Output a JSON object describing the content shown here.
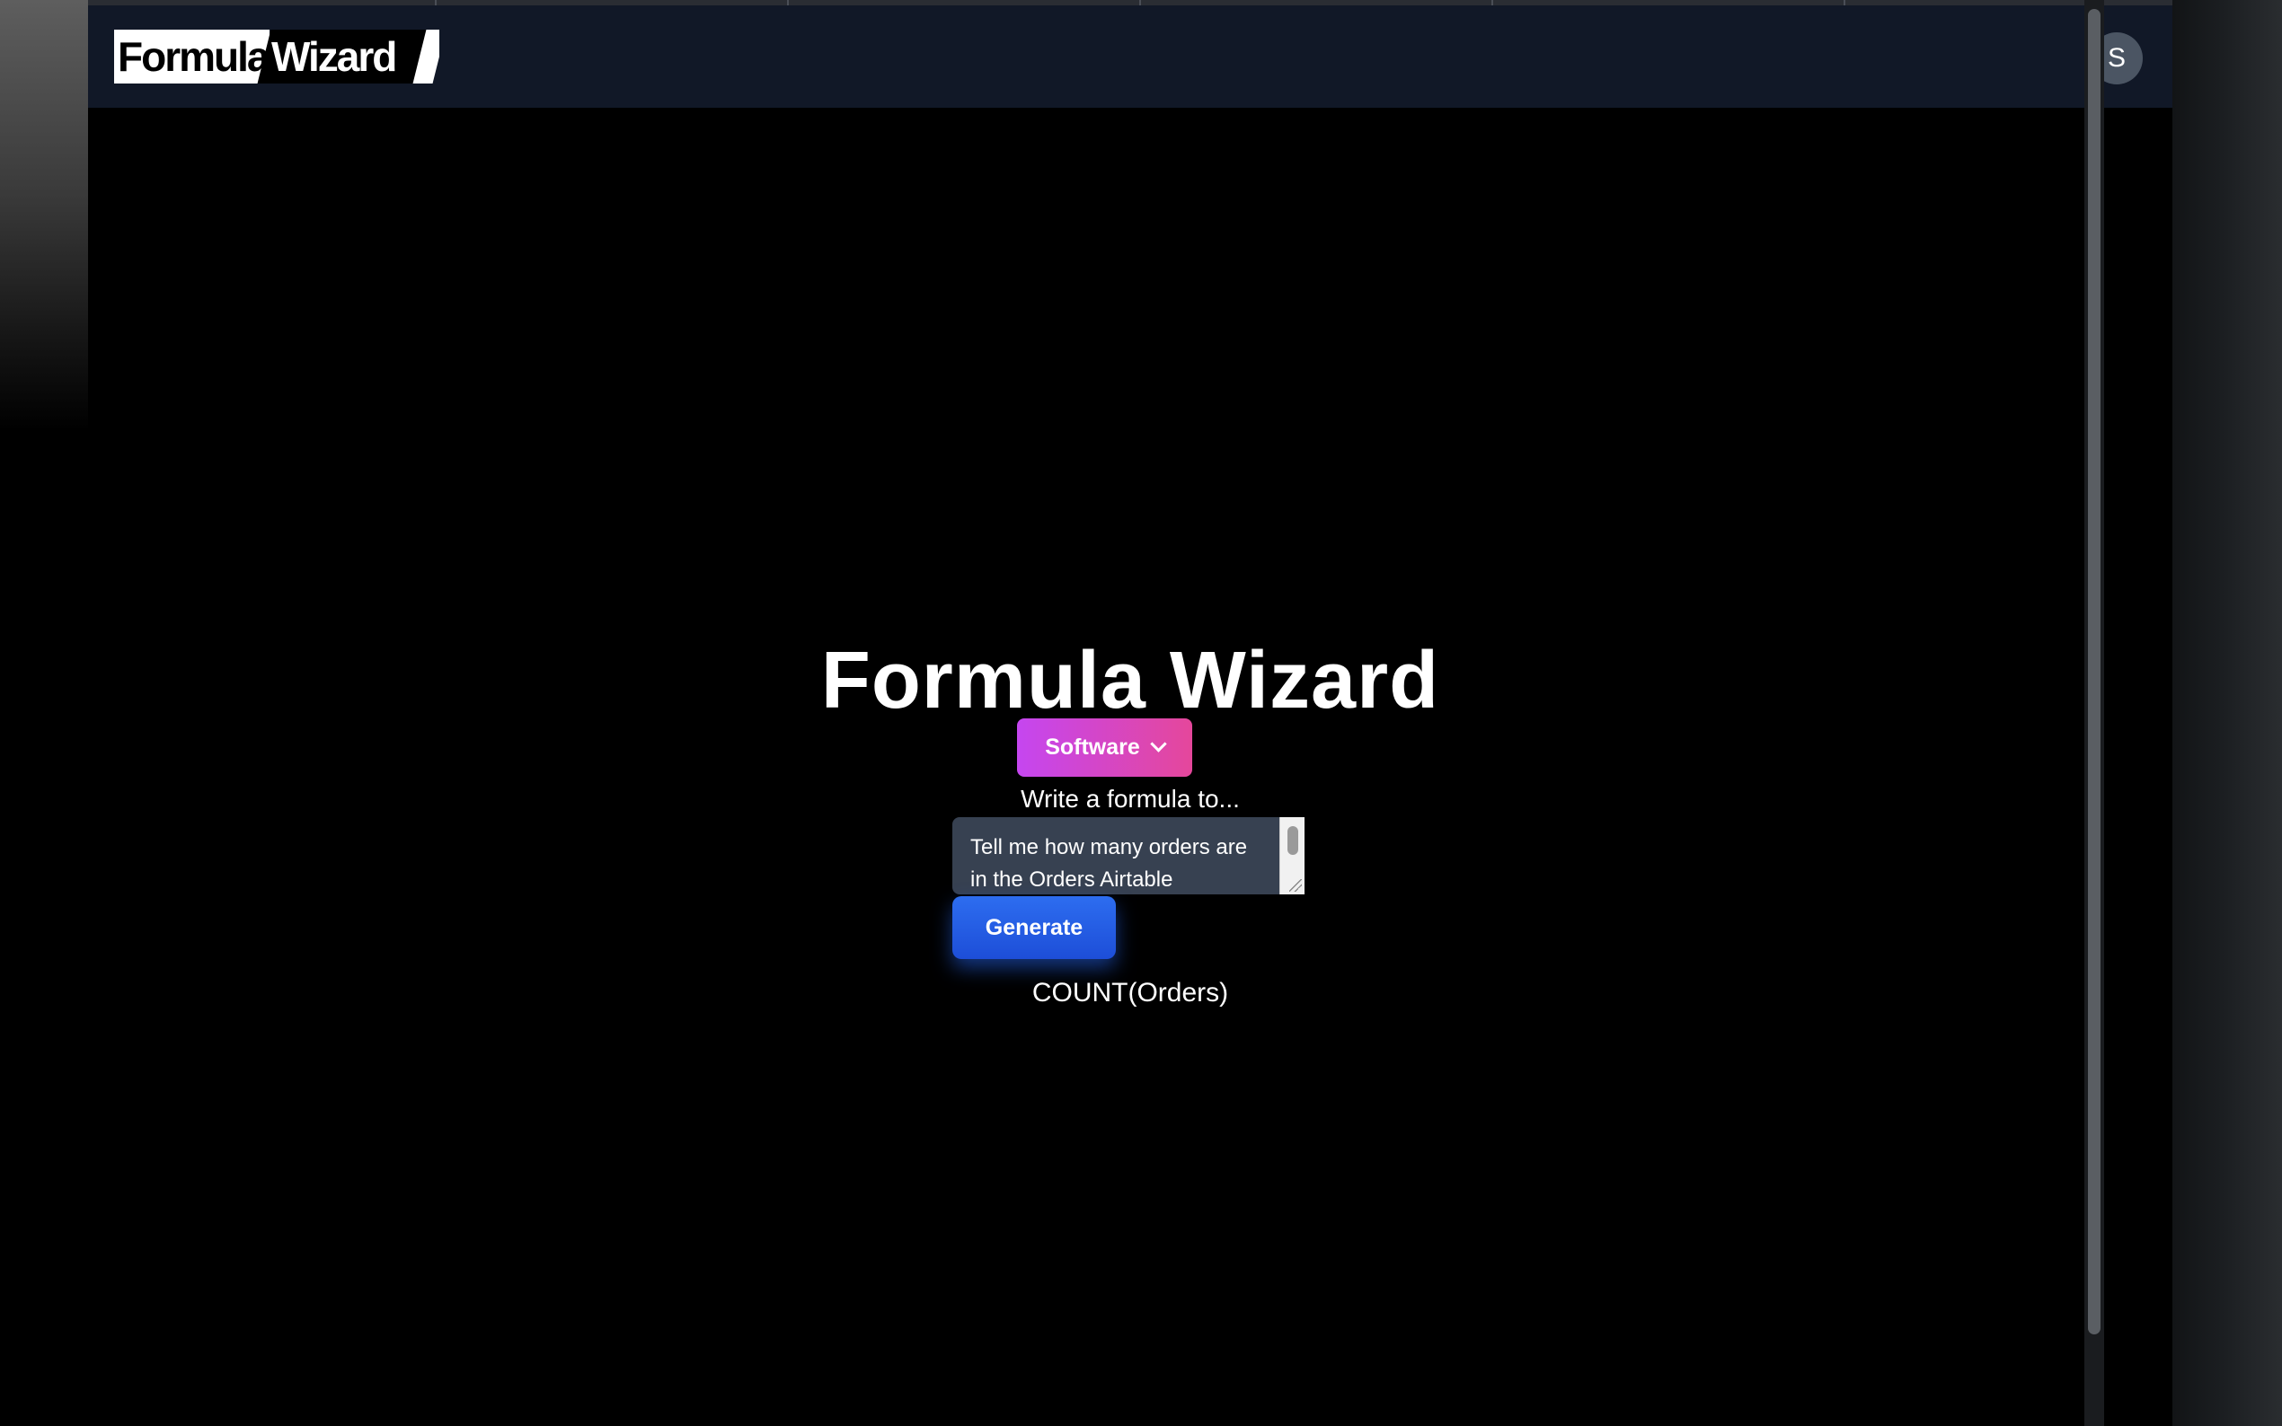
{
  "header": {
    "logo_text_a": "Formula",
    "logo_text_b": "Wizard",
    "avatar_initial": "S"
  },
  "main": {
    "title": "Formula Wizard",
    "category_dropdown": {
      "selected": "Software"
    },
    "prompt_label": "Write a formula to...",
    "prompt_input": {
      "value": "Tell me how many orders are in the Orders Airtable"
    },
    "generate_label": "Generate",
    "result": "COUNT(Orders)"
  },
  "colors": {
    "header_bg": "#111827",
    "page_bg": "#000000",
    "dropdown_gradient_start": "#c546f0",
    "dropdown_gradient_end": "#e5479b",
    "generate_button": "#1d4ed8",
    "input_bg": "#374151",
    "avatar_bg": "#4b5563"
  },
  "icons": {
    "dropdown": "chevron-down-icon"
  }
}
